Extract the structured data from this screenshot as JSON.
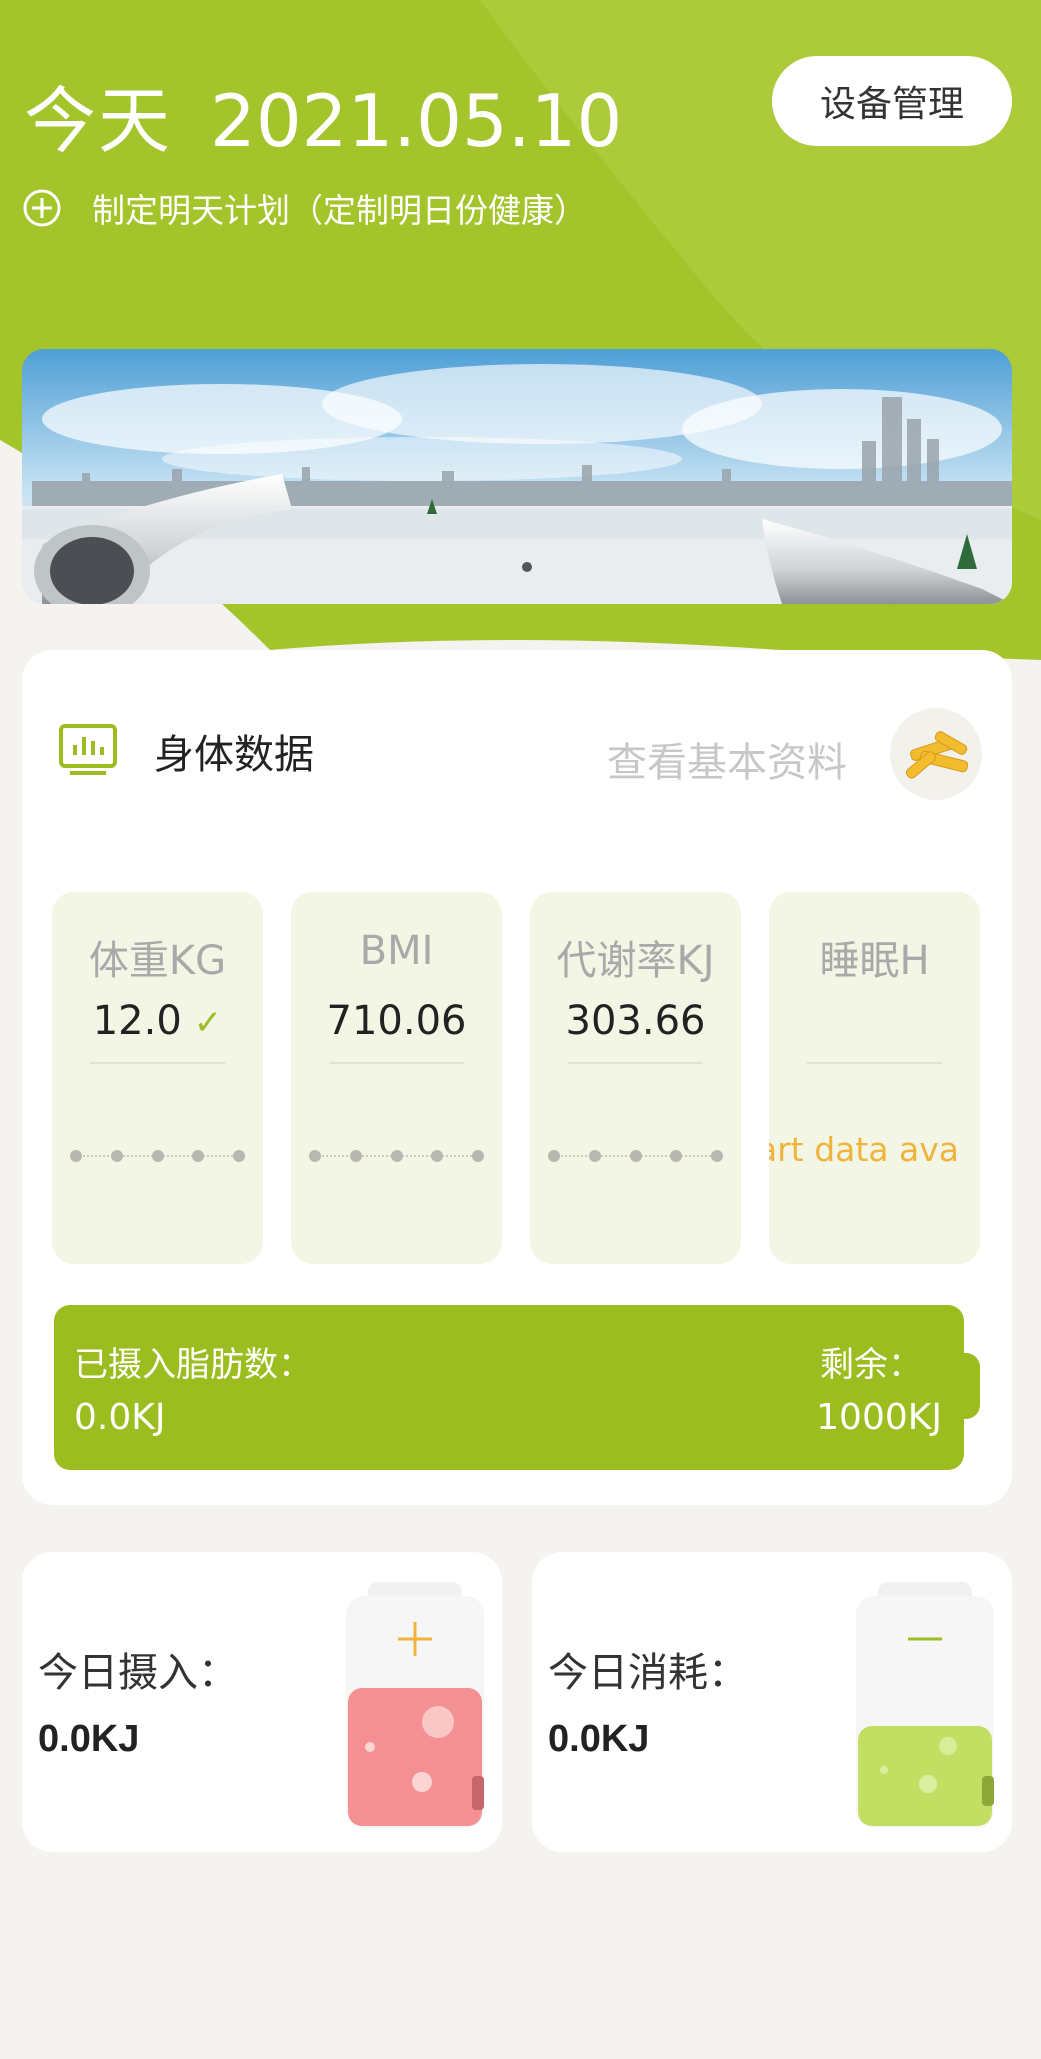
{
  "header": {
    "day_label": "今天",
    "date": "2021.05.10",
    "device_button": "设备管理",
    "plan_text": "制定明天计划（定制明日份健康）"
  },
  "banner": {
    "slide_count": 1,
    "active_slide": 1
  },
  "body_data": {
    "title": "身体数据",
    "view_profile": "查看基本资料",
    "metrics": [
      {
        "label": "体重KG",
        "value": "12.0",
        "checked": true
      },
      {
        "label": "BMI",
        "value": "710.06"
      },
      {
        "label": "代谢率KJ",
        "value": "303.66"
      },
      {
        "label": "睡眠H",
        "value": "",
        "note": "art data ava"
      }
    ],
    "fat": {
      "label": "已摄入脂肪数：",
      "value": "0.0KJ",
      "remain_label": "剩余：",
      "remain_value": "1000KJ"
    }
  },
  "intake": {
    "label": "今日摄入：",
    "value": "0.0KJ"
  },
  "consume": {
    "label": "今日消耗：",
    "value": "0.0KJ"
  },
  "colors": {
    "accent_green": "#9cbd1f",
    "intake_red": "#f48f92",
    "consume_green": "#c2df64",
    "note_orange": "#f0b33c"
  }
}
